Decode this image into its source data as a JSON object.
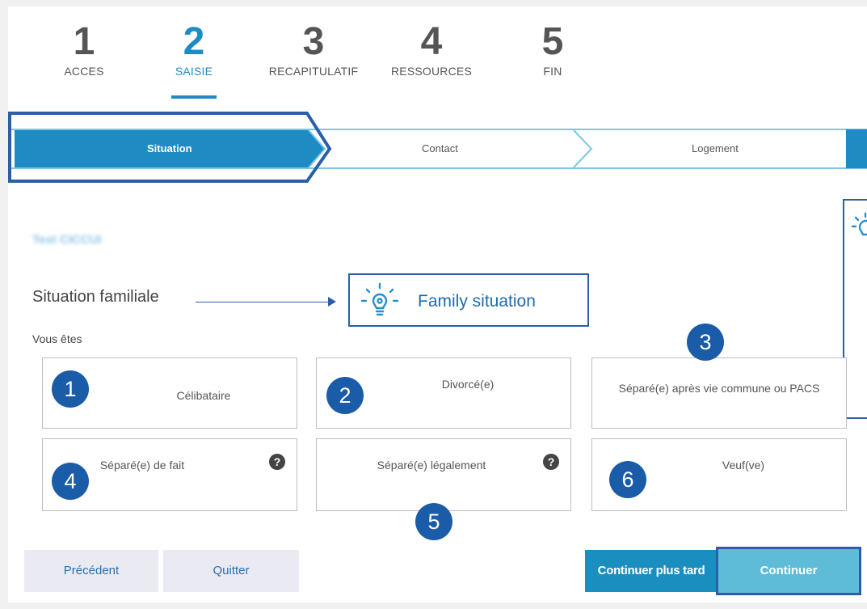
{
  "steps": [
    {
      "num": "1",
      "label": "ACCES"
    },
    {
      "num": "2",
      "label": "SAISIE"
    },
    {
      "num": "3",
      "label": "RECAPITULATIF"
    },
    {
      "num": "4",
      "label": "RESSOURCES"
    },
    {
      "num": "5",
      "label": "FIN"
    }
  ],
  "active_step": "2",
  "substeps": [
    "Situation",
    "Contact",
    "Logement"
  ],
  "blurred_name": "Test CICCUI",
  "section_title": "Situation familiale",
  "callout_text": "Family situation",
  "question": "Vous êtes",
  "options": [
    {
      "label": "Célibataire",
      "badge": "1"
    },
    {
      "label": "Divorcé(e)",
      "badge": "2"
    },
    {
      "label": "Séparé(e) après vie commune ou PACS",
      "badge": "3"
    },
    {
      "label": "Séparé(e) de fait",
      "badge": "4",
      "help": "?"
    },
    {
      "label": "Séparé(e) légalement",
      "badge": "5",
      "help": "?"
    },
    {
      "label": "Veuf(ve)",
      "badge": "6"
    }
  ],
  "buttons": {
    "previous": "Précédent",
    "quit": "Quitter",
    "later": "Continuer plus tard",
    "continue": "Continuer"
  },
  "colors": {
    "accent": "#1e8bc3",
    "annotation": "#2a5fa8",
    "badge": "#1a5ca8"
  },
  "icons": [
    "lightbulb-icon",
    "question-icon"
  ]
}
